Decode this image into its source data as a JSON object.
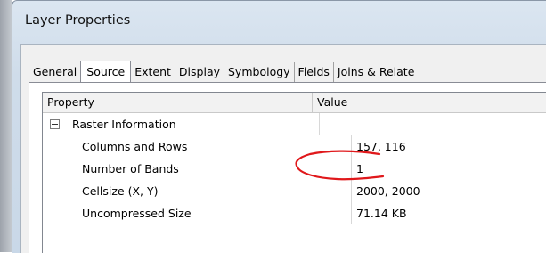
{
  "window": {
    "title": "Layer Properties"
  },
  "tabs": [
    {
      "label": "General",
      "active": false
    },
    {
      "label": "Source",
      "active": true
    },
    {
      "label": "Extent",
      "active": false
    },
    {
      "label": "Display",
      "active": false
    },
    {
      "label": "Symbology",
      "active": false
    },
    {
      "label": "Fields",
      "active": false
    },
    {
      "label": "Joins & Relate",
      "active": false
    }
  ],
  "grid": {
    "headers": {
      "property": "Property",
      "value": "Value"
    },
    "group": {
      "label": "Raster Information",
      "expander_icon": "collapse-minus-icon"
    },
    "rows": [
      {
        "property": "Columns and Rows",
        "value": "157, 116"
      },
      {
        "property": "Number of Bands",
        "value": "1"
      },
      {
        "property": "Cellsize (X, Y)",
        "value": "2000, 2000"
      },
      {
        "property": "Uncompressed Size",
        "value": "71.14 KB"
      }
    ]
  },
  "annotation": {
    "color": "#e0181b",
    "shape": "red-hand-drawn-bracket"
  }
}
